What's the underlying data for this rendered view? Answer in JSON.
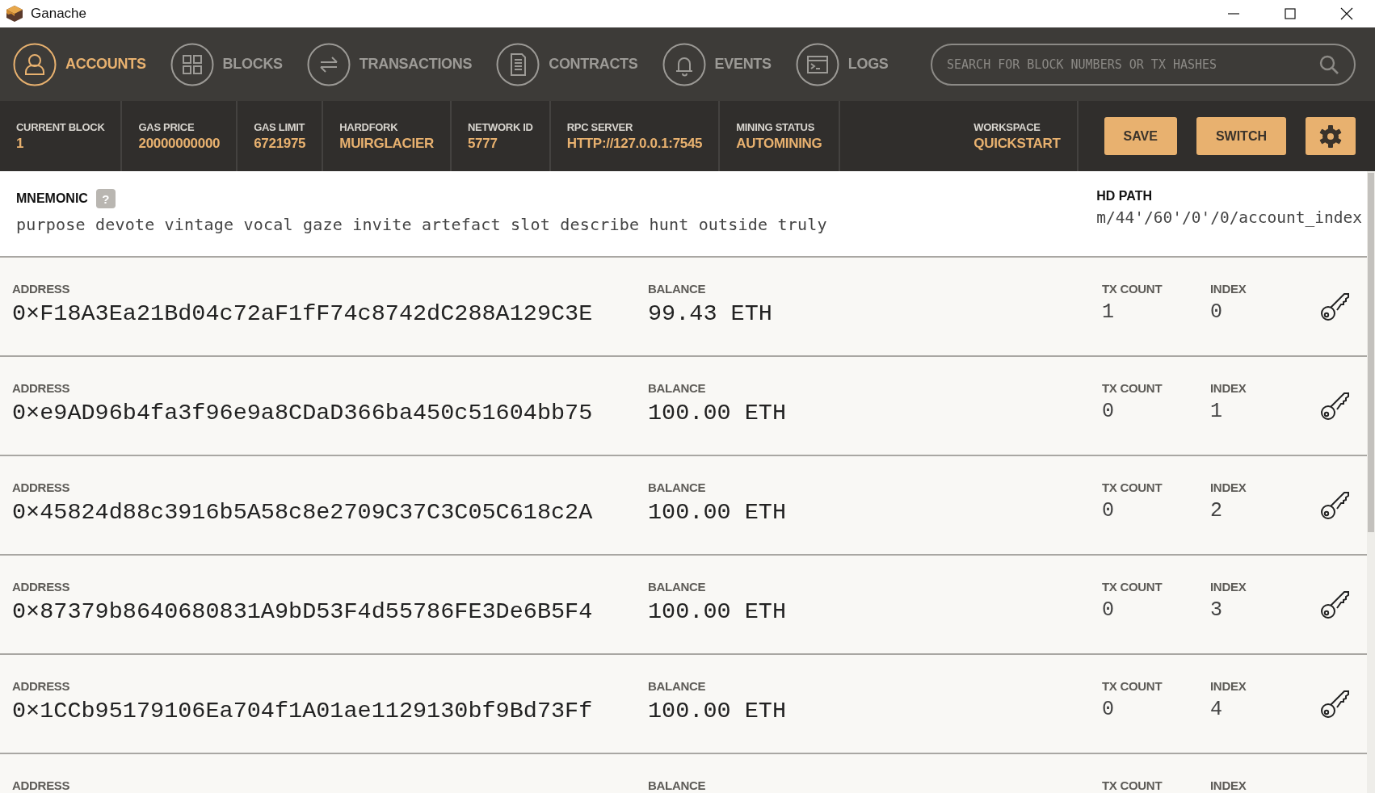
{
  "window": {
    "title": "Ganache"
  },
  "tabs": [
    {
      "label": "ACCOUNTS",
      "kind": "person",
      "selected": true
    },
    {
      "label": "BLOCKS",
      "kind": "grid",
      "selected": false
    },
    {
      "label": "TRANSACTIONS",
      "kind": "arrows",
      "selected": false
    },
    {
      "label": "CONTRACTS",
      "kind": "document",
      "selected": false
    },
    {
      "label": "EVENTS",
      "kind": "bell",
      "selected": false
    },
    {
      "label": "LOGS",
      "kind": "terminal",
      "selected": false
    }
  ],
  "search": {
    "placeholder": "SEARCH FOR BLOCK NUMBERS OR TX HASHES"
  },
  "status_items": [
    {
      "label": "CURRENT BLOCK",
      "value": "1"
    },
    {
      "label": "GAS PRICE",
      "value": "20000000000"
    },
    {
      "label": "GAS LIMIT",
      "value": "6721975"
    },
    {
      "label": "HARDFORK",
      "value": "MUIRGLACIER"
    },
    {
      "label": "NETWORK ID",
      "value": "5777"
    },
    {
      "label": "RPC SERVER",
      "value": "HTTP://127.0.0.1:7545"
    },
    {
      "label": "MINING STATUS",
      "value": "AUTOMINING"
    }
  ],
  "workspace": {
    "label": "WORKSPACE",
    "value": "QUICKSTART"
  },
  "buttons": [
    "SAVE",
    "SWITCH"
  ],
  "mnemonic": {
    "label": "MNEMONIC",
    "help": "?",
    "words": "purpose devote vintage vocal gaze invite artefact slot describe hunt outside truly"
  },
  "hd_path": {
    "label": "HD PATH",
    "value": "m/44'/60'/0'/0/account_index"
  },
  "accounts": [
    {
      "address_label": "ADDRESS",
      "address": "0×F18A3Ea21Bd04c72aF1fF74c8742dC288A129C3E",
      "balance_label": "BALANCE",
      "balance": "99.43 ETH",
      "tx_count_label": "TX COUNT",
      "tx_count": "1",
      "index_label": "INDEX",
      "index": "0"
    },
    {
      "address_label": "ADDRESS",
      "address": "0×e9AD96b4fa3f96e9a8CDaD366ba450c51604bb75",
      "balance_label": "BALANCE",
      "balance": "100.00 ETH",
      "tx_count_label": "TX COUNT",
      "tx_count": "0",
      "index_label": "INDEX",
      "index": "1"
    },
    {
      "address_label": "ADDRESS",
      "address": "0×45824d88c3916b5A58c8e2709C37C3C05C618c2A",
      "balance_label": "BALANCE",
      "balance": "100.00 ETH",
      "tx_count_label": "TX COUNT",
      "tx_count": "0",
      "index_label": "INDEX",
      "index": "2"
    },
    {
      "address_label": "ADDRESS",
      "address": "0×87379b8640680831A9bD53F4d55786FE3De6B5F4",
      "balance_label": "BALANCE",
      "balance": "100.00 ETH",
      "tx_count_label": "TX COUNT",
      "tx_count": "0",
      "index_label": "INDEX",
      "index": "3"
    },
    {
      "address_label": "ADDRESS",
      "address": "0×1CCb95179106Ea704f1A01ae1129130bf9Bd73Ff",
      "balance_label": "BALANCE",
      "balance": "100.00 ETH",
      "tx_count_label": "TX COUNT",
      "tx_count": "0",
      "index_label": "INDEX",
      "index": "4"
    },
    {
      "address_label": "ADDRESS",
      "balance_label": "BALANCE",
      "tx_count_label": "TX COUNT",
      "index_label": "INDEX"
    }
  ]
}
